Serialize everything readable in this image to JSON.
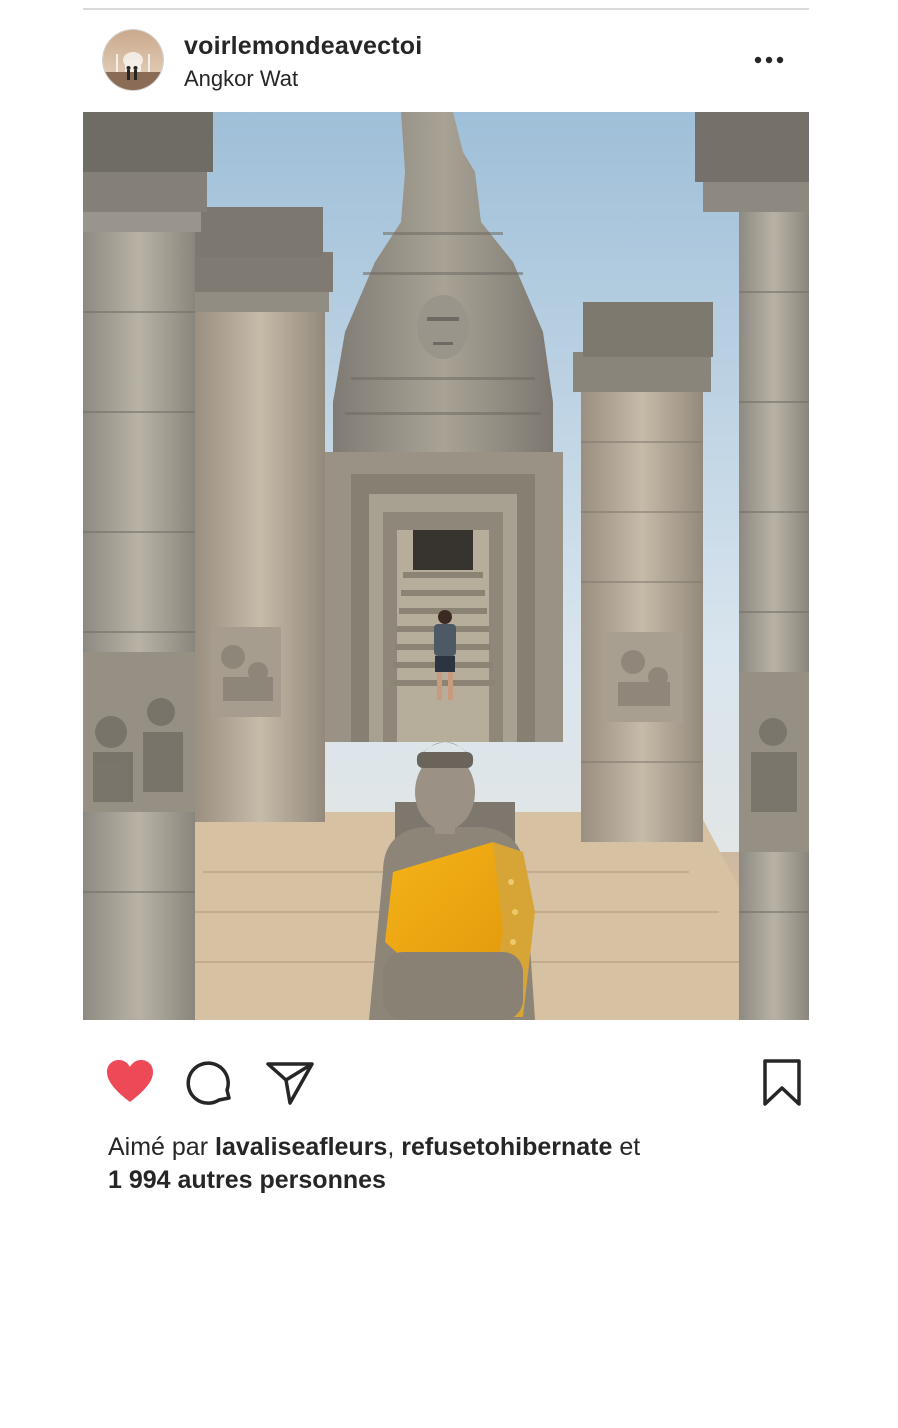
{
  "post": {
    "username": "voirlemondeavectoi",
    "location": "Angkor Wat",
    "liked": true
  },
  "likes": {
    "prefix": "Aimé par",
    "user1": "lavaliseafleurs",
    "separator": ",",
    "user2": "refusetohibernate",
    "conjunction": "et",
    "others": "1 994 autres personnes"
  },
  "icons": {
    "more": "more-options-icon",
    "like": "heart-icon",
    "comment": "comment-icon",
    "share": "paper-plane-icon",
    "save": "bookmark-icon"
  },
  "colors": {
    "like_red": "#ed4956",
    "text": "#262626",
    "divider": "#d9d9d9"
  }
}
